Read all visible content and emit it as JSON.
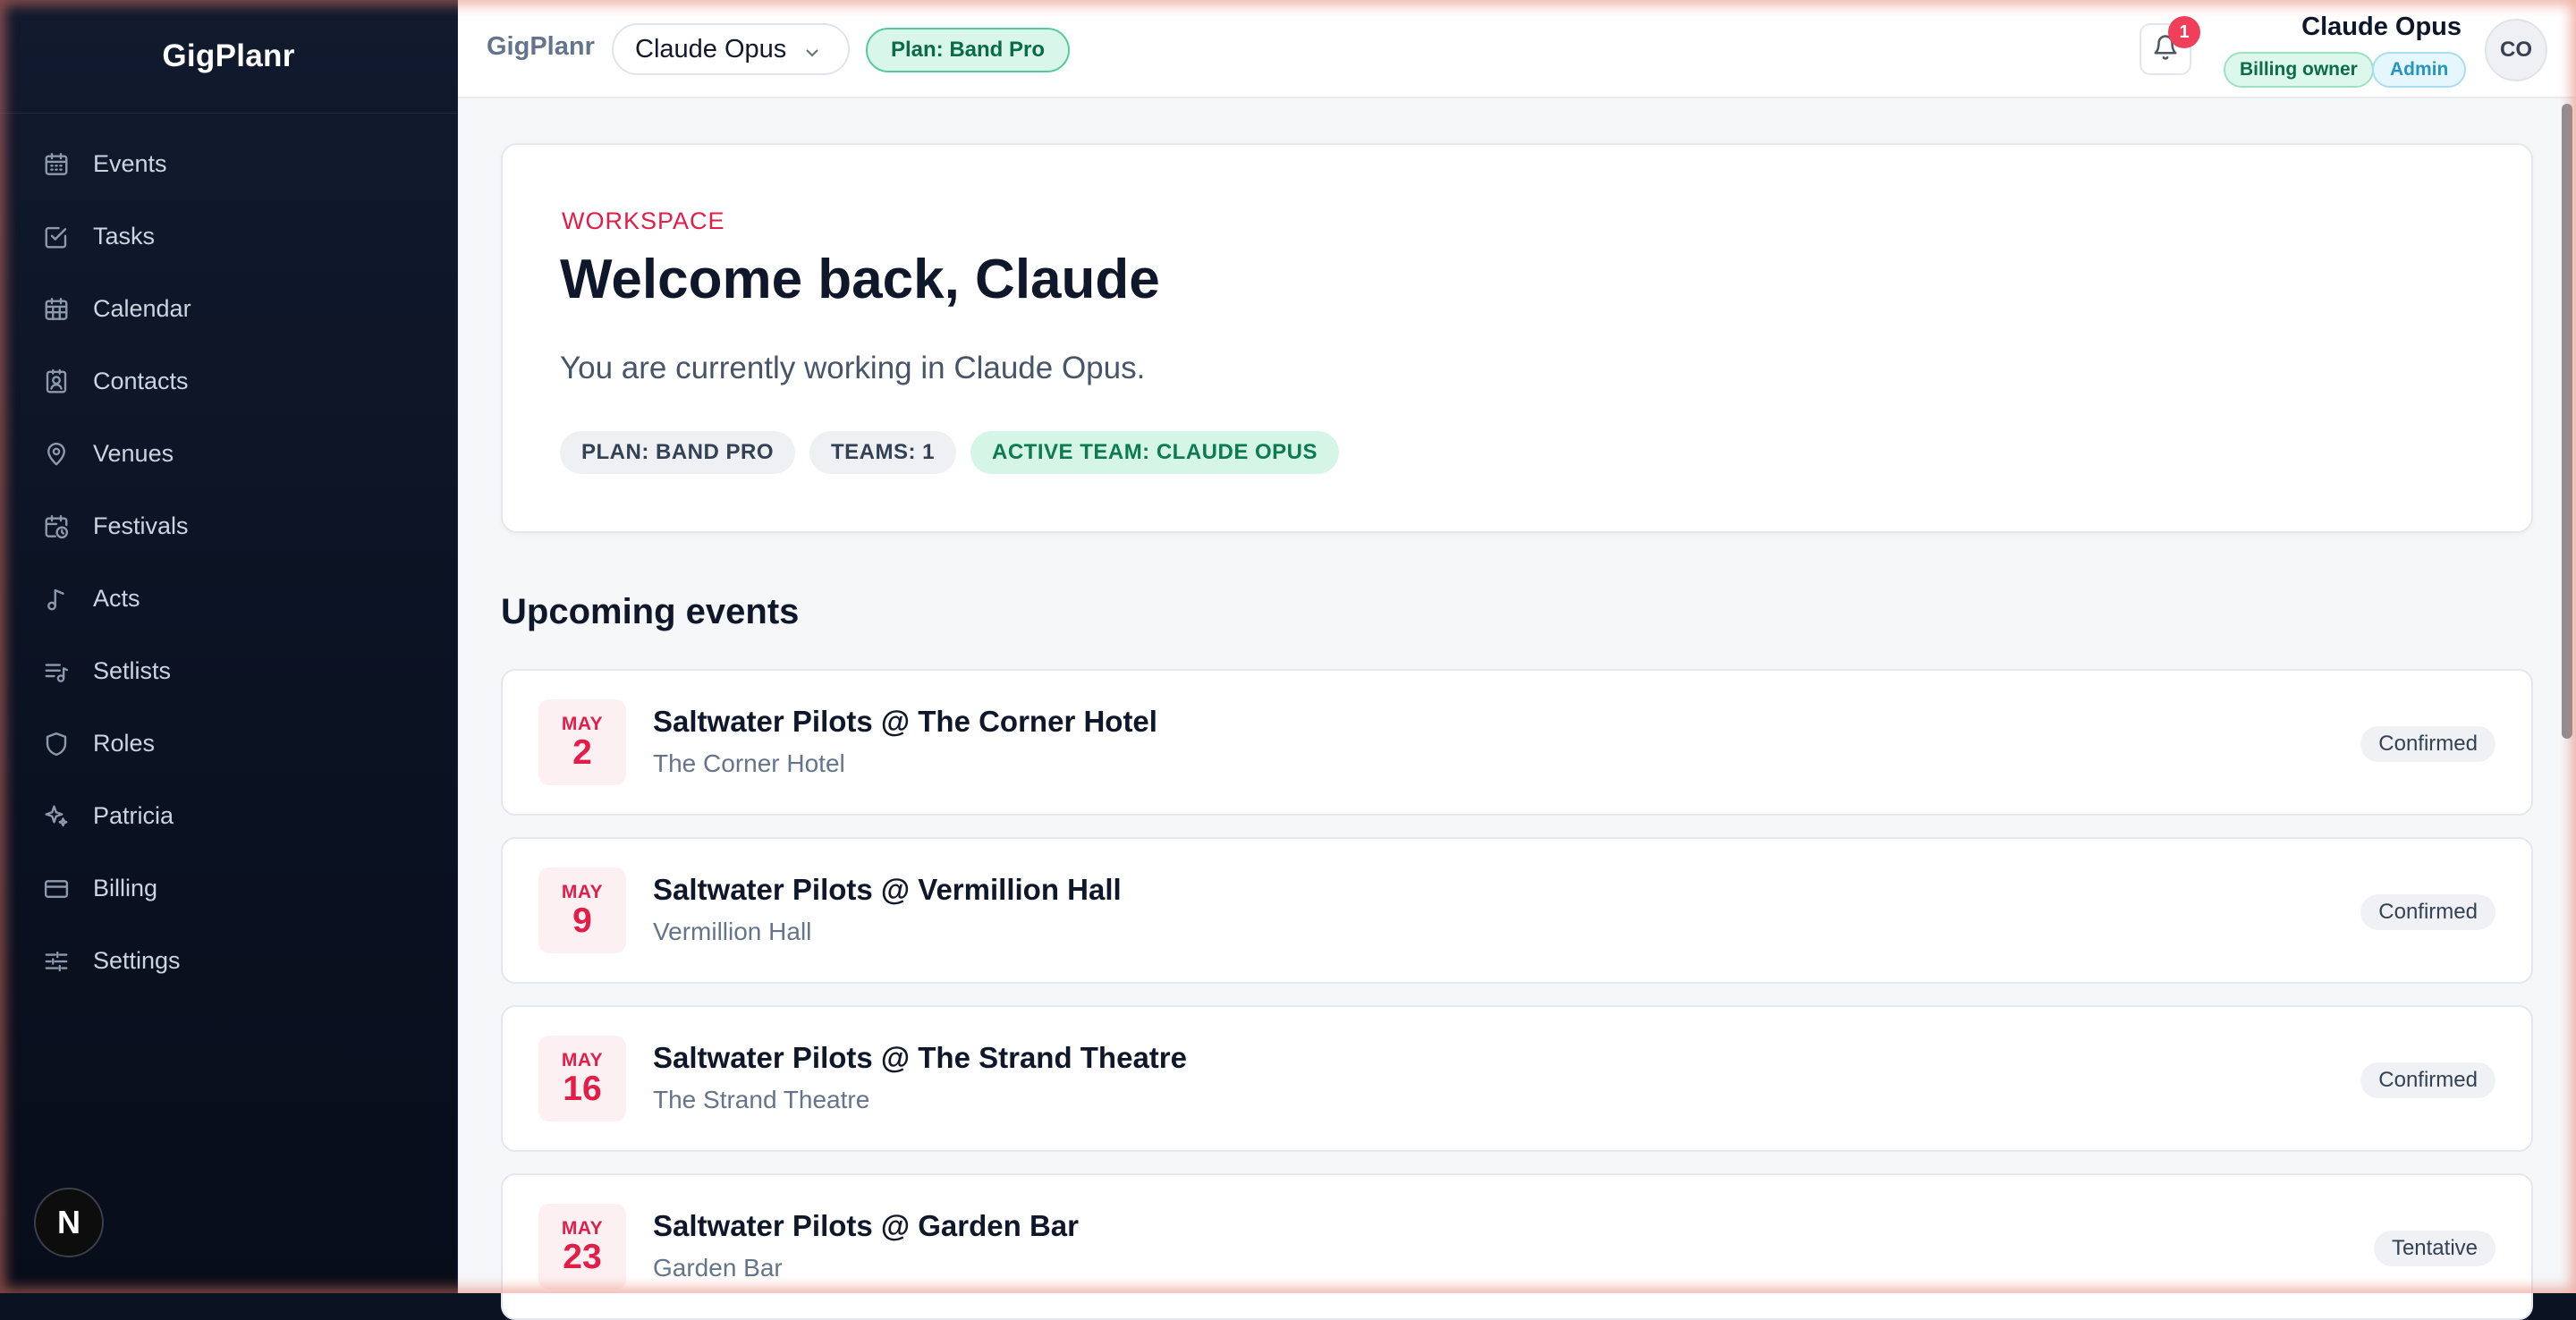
{
  "app": {
    "name": "GigPlanr"
  },
  "sidebar": {
    "brand": "GigPlanr",
    "items": [
      {
        "label": "Events",
        "icon": "calendar-icon"
      },
      {
        "label": "Tasks",
        "icon": "checkbox-icon"
      },
      {
        "label": "Calendar",
        "icon": "calendar-grid-icon"
      },
      {
        "label": "Contacts",
        "icon": "contact-card-icon"
      },
      {
        "label": "Venues",
        "icon": "map-pin-icon"
      },
      {
        "label": "Festivals",
        "icon": "calendar-clock-icon"
      },
      {
        "label": "Acts",
        "icon": "music-note-icon"
      },
      {
        "label": "Setlists",
        "icon": "list-music-icon"
      },
      {
        "label": "Roles",
        "icon": "shield-icon"
      },
      {
        "label": "Patricia",
        "icon": "sparkles-icon"
      },
      {
        "label": "Billing",
        "icon": "credit-card-icon"
      },
      {
        "label": "Settings",
        "icon": "sliders-icon"
      }
    ],
    "dev_badge": "N"
  },
  "topbar": {
    "brand": "GigPlanr",
    "workspace": "Claude Opus",
    "plan_pill": "Plan: Band Pro",
    "notification_count": "1",
    "user_name": "Claude Opus",
    "roles": [
      "Billing owner",
      "Admin"
    ],
    "avatar_initials": "CO"
  },
  "welcome": {
    "eyebrow": "WORKSPACE",
    "title": "Welcome back, Claude",
    "subtitle": "You are currently working in Claude Opus.",
    "chips": [
      "PLAN: BAND PRO",
      "TEAMS: 1",
      "ACTIVE TEAM: CLAUDE OPUS"
    ]
  },
  "upcoming": {
    "title": "Upcoming events",
    "events": [
      {
        "month": "MAY",
        "day": "2",
        "title": "Saltwater Pilots @ The Corner Hotel",
        "venue": "The Corner Hotel",
        "status": "Confirmed"
      },
      {
        "month": "MAY",
        "day": "9",
        "title": "Saltwater Pilots @ Vermillion Hall",
        "venue": "Vermillion Hall",
        "status": "Confirmed"
      },
      {
        "month": "MAY",
        "day": "16",
        "title": "Saltwater Pilots @ The Strand Theatre",
        "venue": "The Strand Theatre",
        "status": "Confirmed"
      },
      {
        "month": "MAY",
        "day": "23",
        "title": "Saltwater Pilots @ Garden Bar",
        "venue": "Garden Bar",
        "status": "Tentative"
      }
    ]
  }
}
